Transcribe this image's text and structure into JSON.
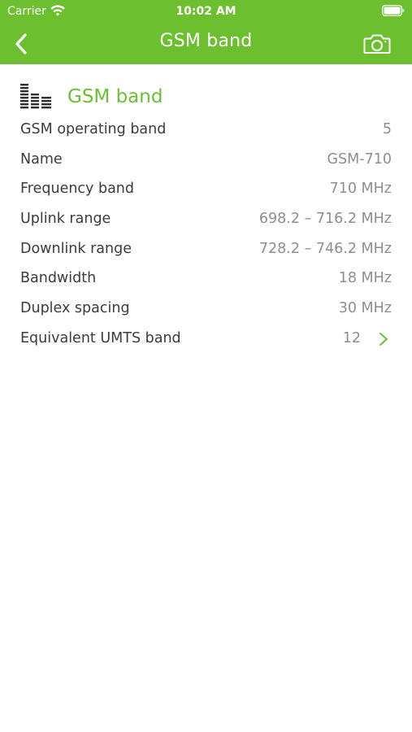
{
  "status_bar": {
    "carrier": "Carrier",
    "time": "10:02 AM",
    "wifi_icon": "wifi-icon",
    "battery_icon": "battery-icon"
  },
  "nav": {
    "title": "GSM band",
    "back_icon": "chevron-left-icon",
    "camera_icon": "camera-icon"
  },
  "section": {
    "icon": "signal-bars-icon",
    "title": "GSM band"
  },
  "rows": [
    {
      "label": "GSM operating band",
      "value": "5"
    },
    {
      "label": "Name",
      "value": "GSM-710"
    },
    {
      "label": "Frequency band",
      "value": "710 MHz"
    },
    {
      "label": "Uplink range",
      "value": "698.2 – 716.2 MHz"
    },
    {
      "label": "Downlink range",
      "value": "728.2 – 746.2 MHz"
    },
    {
      "label": "Bandwidth",
      "value": "18 MHz"
    },
    {
      "label": "Duplex spacing",
      "value": "30 MHz"
    },
    {
      "label": "Equivalent UMTS band",
      "value": "12",
      "chevron_icon": "chevron-right-icon"
    }
  ],
  "colors": {
    "accent": "#6cbf2e",
    "label_text": "#3c3c3c",
    "value_text": "#8e8e8e",
    "background": "#ffffff"
  }
}
